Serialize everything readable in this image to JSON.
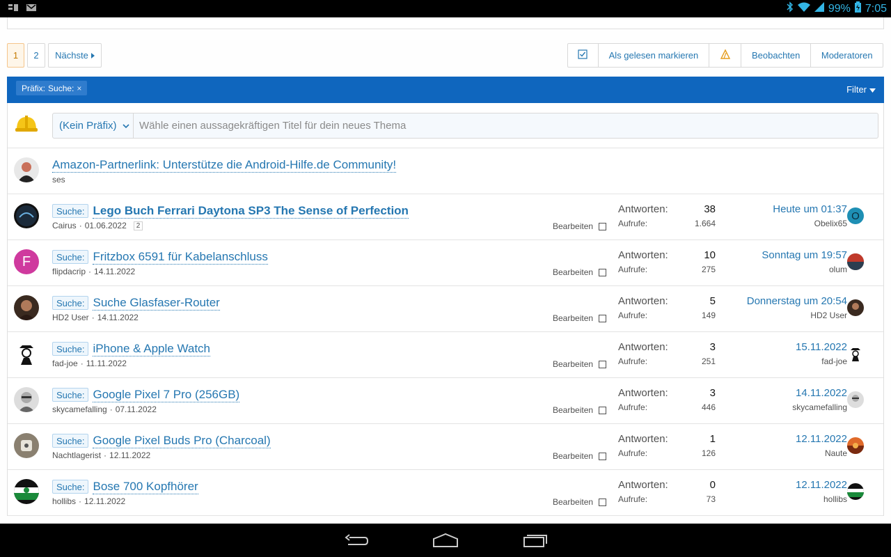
{
  "status": {
    "battery": "99%",
    "time": "7:05"
  },
  "pager": {
    "page1": "1",
    "page2": "2",
    "next": "Nächste"
  },
  "actions": {
    "mark_read": "Als gelesen markieren",
    "watch": "Beobachten",
    "moderators": "Moderatoren"
  },
  "filterbar": {
    "chip_label": "Präfix:",
    "chip_value": "Suche:",
    "filter": "Filter"
  },
  "new_thread": {
    "prefix": "(Kein Präfix)",
    "placeholder": "Wähle einen aussagekräftigen Titel für dein neues Thema"
  },
  "sticky": {
    "title": "Amazon-Partnerlink: Unterstütze die Android-Hilfe.de Community!",
    "author": "ses"
  },
  "labels": {
    "tag": "Suche:",
    "edit": "Bearbeiten",
    "replies": "Antworten:",
    "views": "Aufrufe:"
  },
  "threads": [
    {
      "title": "Lego Buch Ferrari Daytona SP3 The Sense of Perfection",
      "author": "Cairus",
      "date": "01.06.2022",
      "pages": "2",
      "replies": "38",
      "views": "1.664",
      "last_date": "Heute um 01:37",
      "last_user": "Obelix65",
      "last_initial": "O"
    },
    {
      "title": "Fritzbox 6591 für Kabelanschluss",
      "author": "flipdacrip",
      "date": "14.11.2022",
      "replies": "10",
      "views": "275",
      "last_date": "Sonntag um 19:57",
      "last_user": "olum",
      "author_initial": "F"
    },
    {
      "title": "Suche Glasfaser-Router",
      "author": "HD2 User",
      "date": "14.11.2022",
      "replies": "5",
      "views": "149",
      "last_date": "Donnerstag um 20:54",
      "last_user": "HD2 User"
    },
    {
      "title": "iPhone & Apple Watch",
      "author": "fad-joe",
      "date": "11.11.2022",
      "replies": "3",
      "views": "251",
      "last_date": "15.11.2022",
      "last_user": "fad-joe"
    },
    {
      "title": "Google Pixel 7 Pro (256GB)",
      "author": "skycamefalling",
      "date": "07.11.2022",
      "replies": "3",
      "views": "446",
      "last_date": "14.11.2022",
      "last_user": "skycamefalling"
    },
    {
      "title": "Google Pixel Buds Pro (Charcoal)",
      "author": "Nachtlagerist",
      "date": "12.11.2022",
      "replies": "1",
      "views": "126",
      "last_date": "12.11.2022",
      "last_user": "Naute"
    },
    {
      "title": "Bose 700 Kopfhörer",
      "author": "hollibs",
      "date": "12.11.2022",
      "replies": "0",
      "views": "73",
      "last_date": "12.11.2022",
      "last_user": "hollibs"
    }
  ],
  "colors": {
    "accent": "#2577b1",
    "filterbar": "#0f66be",
    "current_page": "#fef6e9"
  }
}
